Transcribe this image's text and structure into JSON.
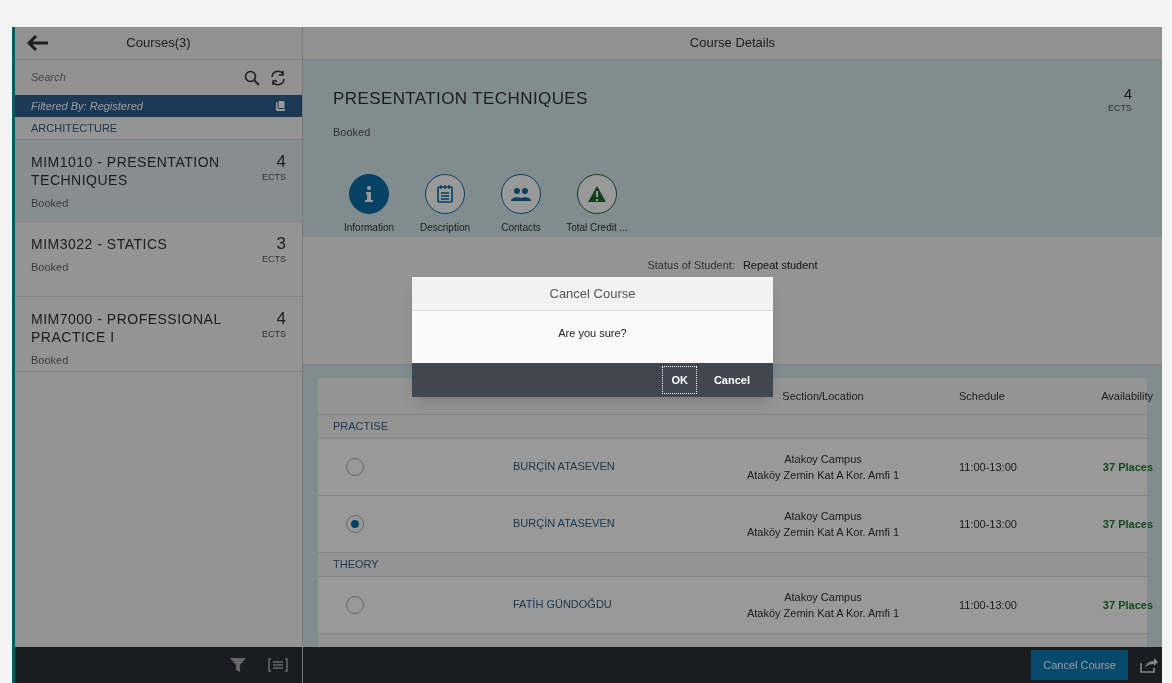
{
  "master": {
    "title": "Courses(3)",
    "search": {
      "placeholder": "Search"
    },
    "filter": "Filtered By: Registered",
    "group": "ARCHITECTURE",
    "items": [
      {
        "title": "MIM1010 - PRESENTATION TECHNIQUES",
        "credits": "4",
        "unit": "ECTS",
        "status": "Booked",
        "selected": true
      },
      {
        "title": "MIM3022 - STATICS",
        "credits": "3",
        "unit": "ECTS",
        "status": "Booked",
        "selected": false
      },
      {
        "title": "MIM7000 - PROFESSIONAL PRACTICE I",
        "credits": "4",
        "unit": "ECTS",
        "status": "Booked",
        "selected": false
      }
    ]
  },
  "detail": {
    "title": "Course Details",
    "header": {
      "title": "PRESENTATION TECHNIQUES",
      "status": "Booked",
      "credits": "4",
      "unit": "ECTS"
    },
    "tabs": [
      {
        "kind": "info",
        "label": "Information",
        "selected": true
      },
      {
        "kind": "description",
        "label": "Description",
        "selected": false
      },
      {
        "kind": "contacts",
        "label": "Contacts",
        "selected": false
      },
      {
        "kind": "warning",
        "label": "Total Credit ...",
        "selected": false
      }
    ],
    "info": {
      "label": "Status of Student:",
      "value": "Repeat student"
    },
    "table": {
      "columns": [
        "Section/Location",
        "Schedule",
        "Availability"
      ],
      "groups": [
        {
          "name": "PRACTISE",
          "rows": [
            {
              "selected": false,
              "instructor": "BURÇİN ATASEVEN",
              "campus": "Atakoy Campus",
              "room": "Ataköy Zemin Kat A Kor. Amfi 1",
              "schedule": "11:00-13:00",
              "availability": "37 Places"
            },
            {
              "selected": true,
              "instructor": "BURÇİN ATASEVEN",
              "campus": "Atakoy Campus",
              "room": "Ataköy Zemin Kat A Kor. Amfi 1",
              "schedule": "11:00-13:00",
              "availability": "37 Places"
            }
          ]
        },
        {
          "name": "THEORY",
          "rows": [
            {
              "selected": false,
              "instructor": "FATİH GÜNDOĞDU",
              "campus": "Atakoy Campus",
              "room": "Ataköy Zemin Kat A Kor. Amfi 1",
              "schedule": "11:00-13:00",
              "availability": "37 Places"
            }
          ]
        }
      ]
    },
    "footer_button": "Cancel Course"
  },
  "dialog": {
    "title": "Cancel Course",
    "message": "Are you sure?",
    "buttons": [
      {
        "label": "OK",
        "focused": true
      },
      {
        "label": "Cancel",
        "focused": false
      }
    ]
  }
}
